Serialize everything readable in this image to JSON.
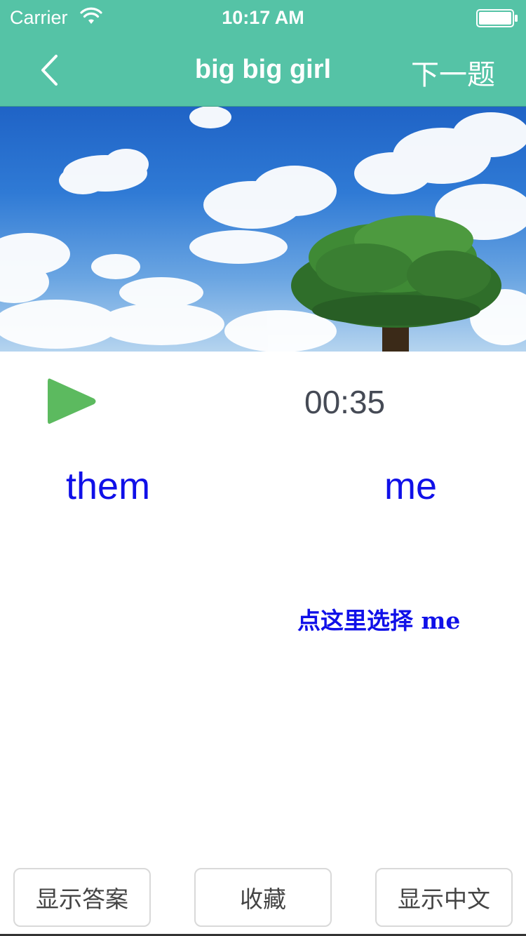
{
  "status_bar": {
    "carrier": "Carrier",
    "time": "10:17 AM"
  },
  "nav": {
    "back_icon": "chevron-left-icon",
    "title": "big big girl",
    "next_label": "下一题"
  },
  "banner": {
    "description_icon": "sky-with-tree-image"
  },
  "player": {
    "play_icon": "play-icon",
    "play_color": "#5cba5f",
    "time": "00:35"
  },
  "choices": {
    "left": "them",
    "right": "me",
    "hint": "点这里选择 me",
    "color": "#1010e8"
  },
  "bottom_buttons": {
    "show_answer": "显示答案",
    "favorite": "收藏",
    "show_chinese": "显示中文"
  },
  "colors": {
    "header": "#55c3a6"
  }
}
